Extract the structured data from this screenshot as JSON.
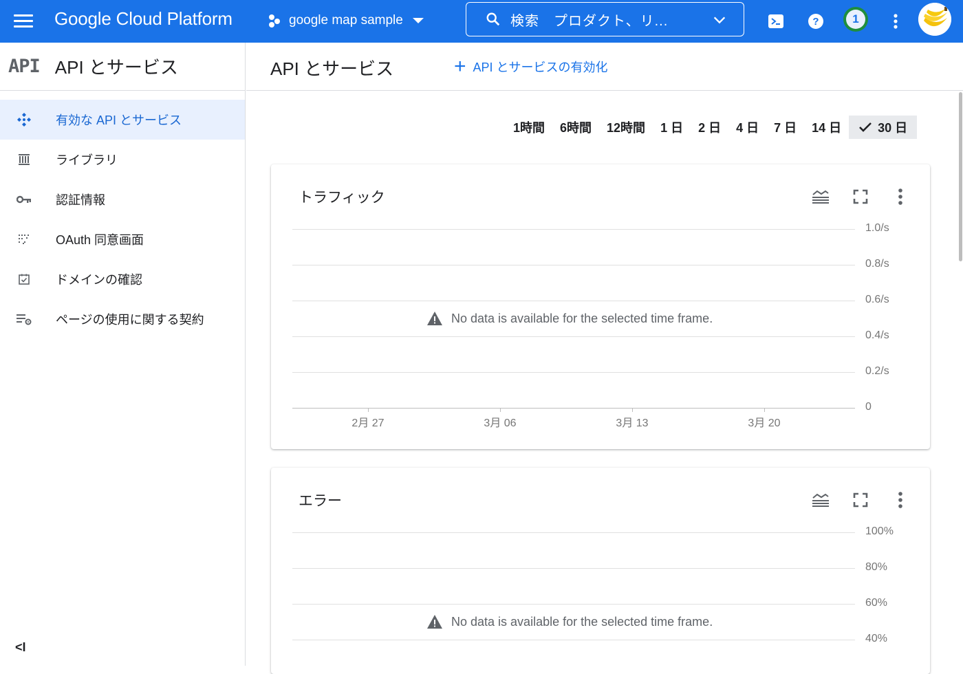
{
  "topbar": {
    "brand": "Google Cloud Platform",
    "project_name": "google map sample",
    "search_text": "検索　プロダクト、リ...",
    "notification_count": "1"
  },
  "sidebar": {
    "logo": "API",
    "title": "API とサービス",
    "items": [
      {
        "label": "有効な API とサービス",
        "icon": "api-diamond-icon",
        "active": true
      },
      {
        "label": "ライブラリ",
        "icon": "library-icon",
        "active": false
      },
      {
        "label": "認証情報",
        "icon": "key-icon",
        "active": false
      },
      {
        "label": "OAuth 同意画面",
        "icon": "oauth-dots-icon",
        "active": false
      },
      {
        "label": "ドメインの確認",
        "icon": "checkbox-icon",
        "active": false
      },
      {
        "label": "ページの使用に関する契約",
        "icon": "list-settings-icon",
        "active": false
      }
    ],
    "collapse_label": "<I"
  },
  "main": {
    "title": "API とサービス",
    "enable_button": "API とサービスの有効化",
    "time_ranges": [
      "1時間",
      "6時間",
      "12時間",
      "1 日",
      "2 日",
      "4 日",
      "7 日",
      "14 日",
      "30 日"
    ],
    "selected_time_range": "30 日"
  },
  "colors": {
    "topbar": "#1a73e8",
    "accent": "#1967d2",
    "active_bg": "#e8f0fe",
    "notification_ring": "#1e8e3e"
  },
  "chart_data": [
    {
      "type": "line",
      "title": "トラフィック",
      "y_ticks": [
        "1.0/s",
        "0.8/s",
        "0.6/s",
        "0.4/s",
        "0.2/s",
        "0"
      ],
      "x_ticks": [
        "2月 27",
        "3月 06",
        "3月 13",
        "3月 20"
      ],
      "ylim": [
        0,
        1.0
      ],
      "series": [],
      "message": "No data is available for the selected time frame."
    },
    {
      "type": "line",
      "title": "エラー",
      "y_ticks": [
        "100%",
        "80%",
        "60%",
        "40%"
      ],
      "x_ticks": [],
      "ylim": [
        0,
        100
      ],
      "series": [],
      "message": "No data is available for the selected time frame."
    }
  ]
}
